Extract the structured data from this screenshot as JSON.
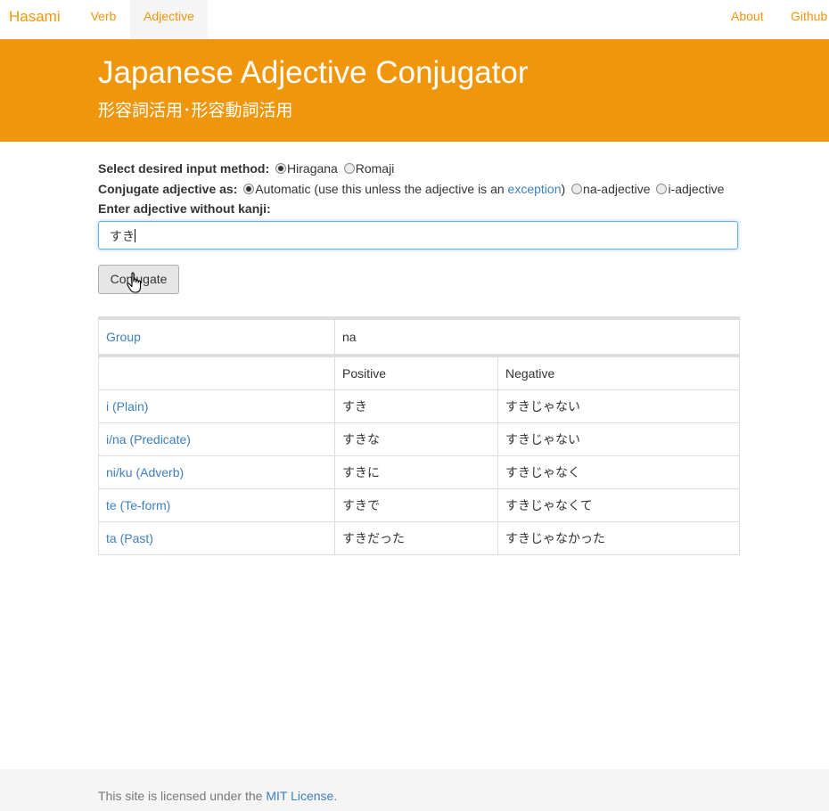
{
  "nav": {
    "brand": "Hasami",
    "links": [
      {
        "label": "Verb",
        "active": false
      },
      {
        "label": "Adjective",
        "active": true
      }
    ],
    "right_links": [
      {
        "label": "About"
      },
      {
        "label": "Github"
      }
    ]
  },
  "header": {
    "title": "Japanese Adjective Conjugator",
    "subtitle": "形容詞活用･形容動詞活用"
  },
  "form": {
    "input_method_label": "Select desired input method:",
    "input_method_options": [
      "Hiragana",
      "Romaji"
    ],
    "input_method_selected": "Hiragana",
    "conjugate_as_label": "Conjugate adjective as:",
    "automatic_label": "Automatic (use this unless the adjective is an ",
    "exception_link": "exception",
    "automatic_close": ")",
    "na_option": "na-adjective",
    "i_option": "i-adjective",
    "enter_label": "Enter adjective without kanji:",
    "input_value": "すき",
    "button_label": "Conjugate"
  },
  "results": {
    "group_label": "Group",
    "group_value": "na",
    "columns": [
      "",
      "Positive",
      "Negative"
    ],
    "rows": [
      {
        "label": "i (Plain)",
        "positive": "すき",
        "negative": "すきじゃない"
      },
      {
        "label": "i/na (Predicate)",
        "positive": "すきな",
        "negative": "すきじゃない"
      },
      {
        "label": "ni/ku (Adverb)",
        "positive": "すきに",
        "negative": "すきじゃなく"
      },
      {
        "label": "te (Te-form)",
        "positive": "すきで",
        "negative": "すきじゃなくて"
      },
      {
        "label": "ta (Past)",
        "positive": "すきだった",
        "negative": "すきじゃなかった"
      }
    ]
  },
  "footer": {
    "prefix": "This site is licensed under the ",
    "link": "MIT License",
    "suffix": "."
  },
  "colors": {
    "accent": "#f0960a",
    "link": "#3e7fbf"
  }
}
